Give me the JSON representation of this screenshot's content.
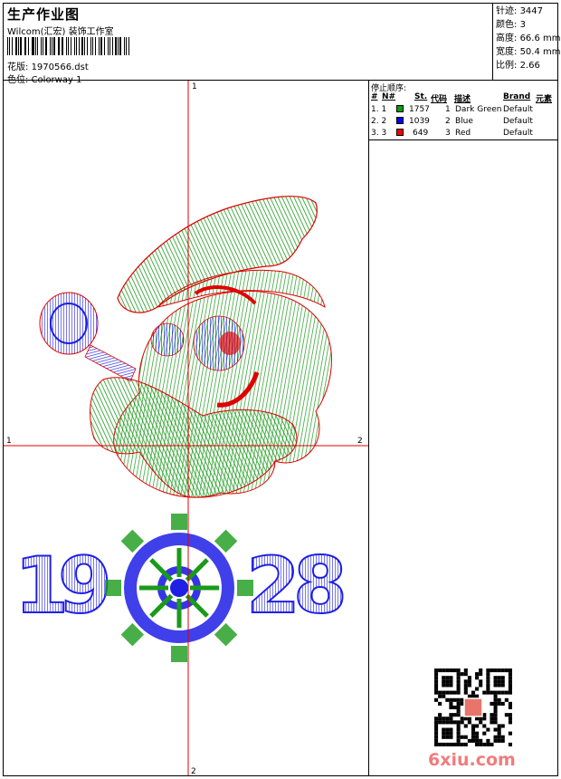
{
  "header": {
    "title": "生产作业图",
    "company": "Wilcom(汇宏) 装饰工作室",
    "design_label": "花版:",
    "design_value": "1970566.dst",
    "colorway_label": "色位:",
    "colorway_value": "Colorway 1"
  },
  "stats": {
    "stitches_label": "针迹:",
    "stitches": "3447",
    "colors_label": "颜色:",
    "colors": "3",
    "height_label": "高度:",
    "height": "66.6 mm",
    "width_label": "宽度:",
    "width": "50.4 mm",
    "scale_label": "比例:",
    "scale": "2.66"
  },
  "sequence": {
    "title": "停止顺序:",
    "headers": [
      "#",
      "N#",
      "St.",
      "代码",
      "描述",
      "Brand",
      "元素"
    ],
    "rows": [
      {
        "index": "1. 1",
        "stitches": "1757",
        "code": "1",
        "desc": "Dark Green",
        "brand": "Default",
        "color": "#00a000"
      },
      {
        "index": "2. 2",
        "stitches": "1039",
        "code": "2",
        "desc": "Blue",
        "brand": "Default",
        "color": "#0000ff"
      },
      {
        "index": "3. 3",
        "stitches": "649",
        "code": "3",
        "desc": "Red",
        "brand": "Default",
        "color": "#ff0000"
      }
    ]
  },
  "axes": {
    "top": "1",
    "bottom": "2",
    "left": "1",
    "right": "2"
  },
  "artwork": {
    "digits": [
      "1",
      "9",
      "2",
      "8"
    ],
    "thread_colors": {
      "green": "#1a9a1a",
      "blue": "#1f1fe6",
      "red": "#e00000"
    }
  },
  "watermark": {
    "text": "6xiu.com"
  }
}
